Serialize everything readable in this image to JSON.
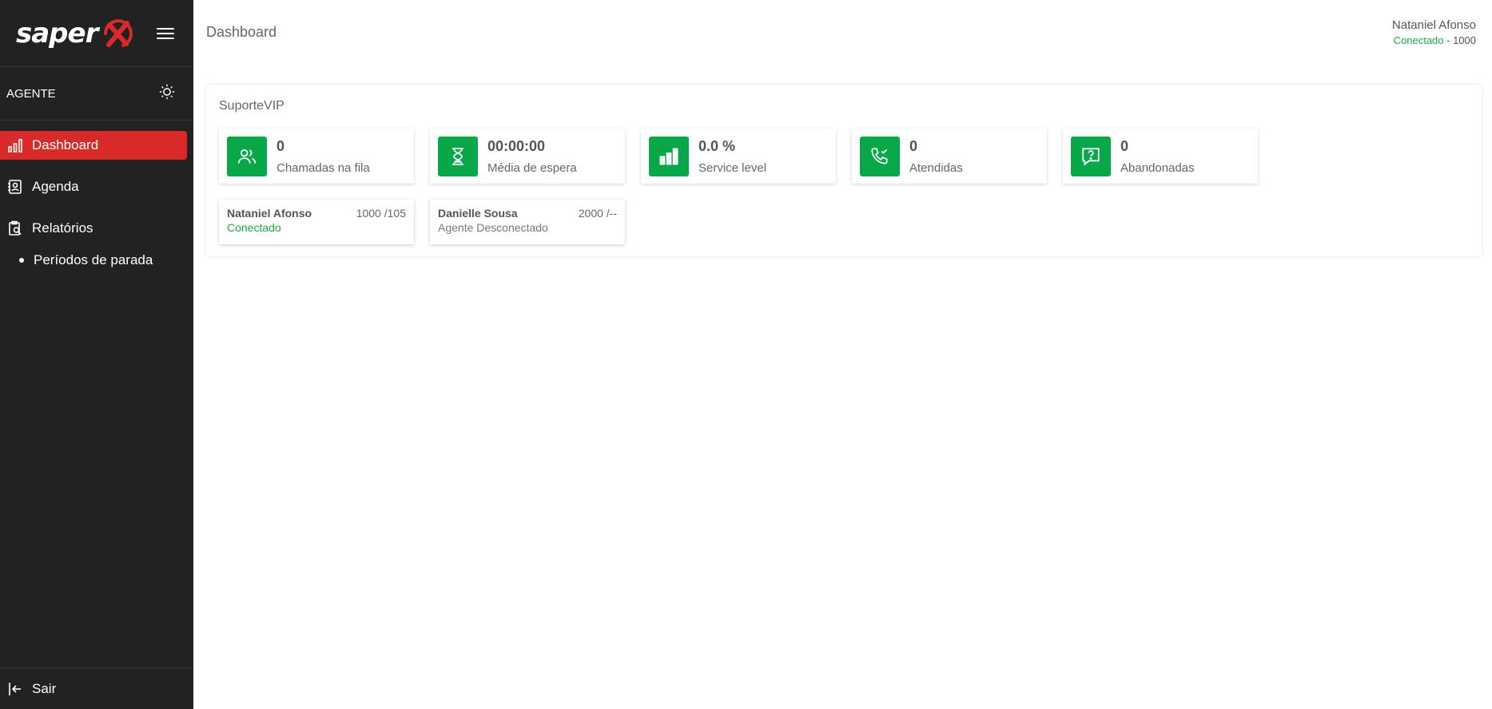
{
  "brand": {
    "logo_text": "saper"
  },
  "sidebar": {
    "role_label": "AGENTE",
    "items": [
      {
        "label": "Dashboard",
        "icon": "bar-chart-icon",
        "active": true
      },
      {
        "label": "Agenda",
        "icon": "contact-book-icon"
      },
      {
        "label": "Relatórios",
        "icon": "report-clipboard-icon"
      }
    ],
    "sub_items": [
      {
        "label": "Períodos de parada"
      }
    ],
    "logout_label": "Sair"
  },
  "header": {
    "title": "Dashboard",
    "user_name": "Nataniel Afonso",
    "user_status": "Conectado",
    "user_separator": " - ",
    "user_extension": "1000"
  },
  "queue": {
    "name": "SuporteVIP",
    "stats": [
      {
        "value": "0",
        "label": "Chamadas na fila",
        "icon": "users-icon"
      },
      {
        "value": "00:00:00",
        "label": "Média de espera",
        "icon": "hourglass-icon"
      },
      {
        "value": "0.0 %",
        "label": "Service level",
        "icon": "bar-level-icon"
      },
      {
        "value": "0",
        "label": "Atendidas",
        "icon": "phone-check-icon"
      },
      {
        "value": "0",
        "label": "Abandonadas",
        "icon": "question-message-icon"
      }
    ],
    "agents": [
      {
        "name": "Nataniel Afonso",
        "extension": "1000 /105",
        "status": "Conectado"
      },
      {
        "name": "Danielle Sousa",
        "extension": "2000 /--",
        "status": "Agente Desconectado"
      }
    ]
  },
  "colors": {
    "sidebar_bg": "#222222",
    "active_red": "#d92a2a",
    "accent_green": "#08a84a",
    "status_green": "#1aab4a"
  }
}
